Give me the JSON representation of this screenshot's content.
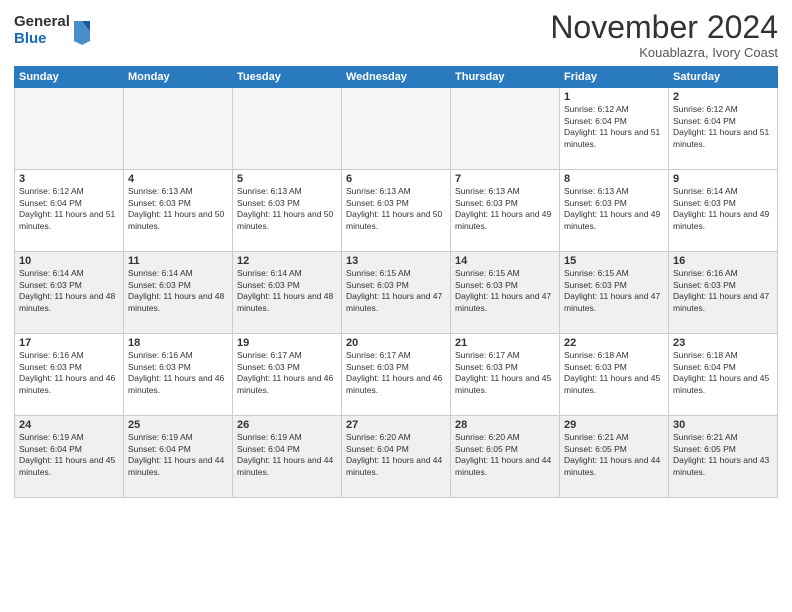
{
  "header": {
    "logo_general": "General",
    "logo_blue": "Blue",
    "month_title": "November 2024",
    "location": "Kouablazra, Ivory Coast"
  },
  "days_of_week": [
    "Sunday",
    "Monday",
    "Tuesday",
    "Wednesday",
    "Thursday",
    "Friday",
    "Saturday"
  ],
  "weeks": [
    [
      {
        "day": "",
        "empty": true
      },
      {
        "day": "",
        "empty": true
      },
      {
        "day": "",
        "empty": true
      },
      {
        "day": "",
        "empty": true
      },
      {
        "day": "",
        "empty": true
      },
      {
        "day": "1",
        "sunrise": "Sunrise: 6:12 AM",
        "sunset": "Sunset: 6:04 PM",
        "daylight": "Daylight: 11 hours and 51 minutes."
      },
      {
        "day": "2",
        "sunrise": "Sunrise: 6:12 AM",
        "sunset": "Sunset: 6:04 PM",
        "daylight": "Daylight: 11 hours and 51 minutes."
      }
    ],
    [
      {
        "day": "3",
        "sunrise": "Sunrise: 6:12 AM",
        "sunset": "Sunset: 6:04 PM",
        "daylight": "Daylight: 11 hours and 51 minutes."
      },
      {
        "day": "4",
        "sunrise": "Sunrise: 6:13 AM",
        "sunset": "Sunset: 6:03 PM",
        "daylight": "Daylight: 11 hours and 50 minutes."
      },
      {
        "day": "5",
        "sunrise": "Sunrise: 6:13 AM",
        "sunset": "Sunset: 6:03 PM",
        "daylight": "Daylight: 11 hours and 50 minutes."
      },
      {
        "day": "6",
        "sunrise": "Sunrise: 6:13 AM",
        "sunset": "Sunset: 6:03 PM",
        "daylight": "Daylight: 11 hours and 50 minutes."
      },
      {
        "day": "7",
        "sunrise": "Sunrise: 6:13 AM",
        "sunset": "Sunset: 6:03 PM",
        "daylight": "Daylight: 11 hours and 49 minutes."
      },
      {
        "day": "8",
        "sunrise": "Sunrise: 6:13 AM",
        "sunset": "Sunset: 6:03 PM",
        "daylight": "Daylight: 11 hours and 49 minutes."
      },
      {
        "day": "9",
        "sunrise": "Sunrise: 6:14 AM",
        "sunset": "Sunset: 6:03 PM",
        "daylight": "Daylight: 11 hours and 49 minutes."
      }
    ],
    [
      {
        "day": "10",
        "sunrise": "Sunrise: 6:14 AM",
        "sunset": "Sunset: 6:03 PM",
        "daylight": "Daylight: 11 hours and 48 minutes."
      },
      {
        "day": "11",
        "sunrise": "Sunrise: 6:14 AM",
        "sunset": "Sunset: 6:03 PM",
        "daylight": "Daylight: 11 hours and 48 minutes."
      },
      {
        "day": "12",
        "sunrise": "Sunrise: 6:14 AM",
        "sunset": "Sunset: 6:03 PM",
        "daylight": "Daylight: 11 hours and 48 minutes."
      },
      {
        "day": "13",
        "sunrise": "Sunrise: 6:15 AM",
        "sunset": "Sunset: 6:03 PM",
        "daylight": "Daylight: 11 hours and 47 minutes."
      },
      {
        "day": "14",
        "sunrise": "Sunrise: 6:15 AM",
        "sunset": "Sunset: 6:03 PM",
        "daylight": "Daylight: 11 hours and 47 minutes."
      },
      {
        "day": "15",
        "sunrise": "Sunrise: 6:15 AM",
        "sunset": "Sunset: 6:03 PM",
        "daylight": "Daylight: 11 hours and 47 minutes."
      },
      {
        "day": "16",
        "sunrise": "Sunrise: 6:16 AM",
        "sunset": "Sunset: 6:03 PM",
        "daylight": "Daylight: 11 hours and 47 minutes."
      }
    ],
    [
      {
        "day": "17",
        "sunrise": "Sunrise: 6:16 AM",
        "sunset": "Sunset: 6:03 PM",
        "daylight": "Daylight: 11 hours and 46 minutes."
      },
      {
        "day": "18",
        "sunrise": "Sunrise: 6:16 AM",
        "sunset": "Sunset: 6:03 PM",
        "daylight": "Daylight: 11 hours and 46 minutes."
      },
      {
        "day": "19",
        "sunrise": "Sunrise: 6:17 AM",
        "sunset": "Sunset: 6:03 PM",
        "daylight": "Daylight: 11 hours and 46 minutes."
      },
      {
        "day": "20",
        "sunrise": "Sunrise: 6:17 AM",
        "sunset": "Sunset: 6:03 PM",
        "daylight": "Daylight: 11 hours and 46 minutes."
      },
      {
        "day": "21",
        "sunrise": "Sunrise: 6:17 AM",
        "sunset": "Sunset: 6:03 PM",
        "daylight": "Daylight: 11 hours and 45 minutes."
      },
      {
        "day": "22",
        "sunrise": "Sunrise: 6:18 AM",
        "sunset": "Sunset: 6:03 PM",
        "daylight": "Daylight: 11 hours and 45 minutes."
      },
      {
        "day": "23",
        "sunrise": "Sunrise: 6:18 AM",
        "sunset": "Sunset: 6:04 PM",
        "daylight": "Daylight: 11 hours and 45 minutes."
      }
    ],
    [
      {
        "day": "24",
        "sunrise": "Sunrise: 6:19 AM",
        "sunset": "Sunset: 6:04 PM",
        "daylight": "Daylight: 11 hours and 45 minutes."
      },
      {
        "day": "25",
        "sunrise": "Sunrise: 6:19 AM",
        "sunset": "Sunset: 6:04 PM",
        "daylight": "Daylight: 11 hours and 44 minutes."
      },
      {
        "day": "26",
        "sunrise": "Sunrise: 6:19 AM",
        "sunset": "Sunset: 6:04 PM",
        "daylight": "Daylight: 11 hours and 44 minutes."
      },
      {
        "day": "27",
        "sunrise": "Sunrise: 6:20 AM",
        "sunset": "Sunset: 6:04 PM",
        "daylight": "Daylight: 11 hours and 44 minutes."
      },
      {
        "day": "28",
        "sunrise": "Sunrise: 6:20 AM",
        "sunset": "Sunset: 6:05 PM",
        "daylight": "Daylight: 11 hours and 44 minutes."
      },
      {
        "day": "29",
        "sunrise": "Sunrise: 6:21 AM",
        "sunset": "Sunset: 6:05 PM",
        "daylight": "Daylight: 11 hours and 44 minutes."
      },
      {
        "day": "30",
        "sunrise": "Sunrise: 6:21 AM",
        "sunset": "Sunset: 6:05 PM",
        "daylight": "Daylight: 11 hours and 43 minutes."
      }
    ]
  ]
}
